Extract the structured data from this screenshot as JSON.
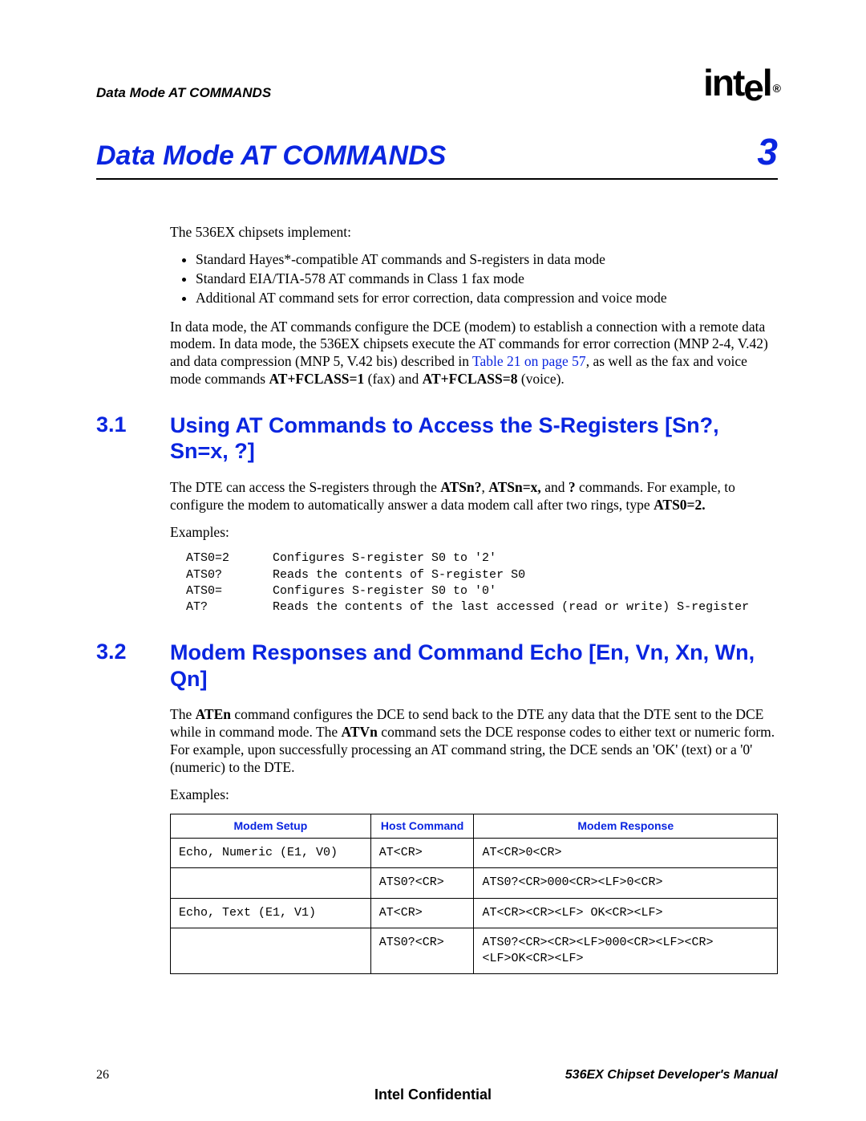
{
  "header": {
    "running_title": "Data Mode AT COMMANDS",
    "logo_text": "intel",
    "logo_reg": "®"
  },
  "chapter": {
    "title": "Data Mode AT COMMANDS",
    "number": "3"
  },
  "intro": {
    "lead": "The 536EX chipsets implement:",
    "bullets": [
      "Standard Hayes*-compatible AT commands and S-registers in data mode",
      "Standard EIA/TIA-578 AT commands in Class 1 fax mode",
      "Additional AT command sets for error correction, data compression and voice mode"
    ],
    "para_pre": "In data mode, the AT commands configure the DCE (modem) to establish a connection with a remote data modem. In data mode, the 536EX chipsets execute the AT commands for error correction (MNP 2-4, V.42) and data compression (MNP 5, V.42 bis) described in ",
    "xref": "Table 21 on page 57",
    "para_mid": ", as well as the fax and voice mode commands ",
    "cmd1": "AT+FCLASS=1",
    "mid2": " (fax) and ",
    "cmd2": "AT+FCLASS=8",
    "para_post": " (voice)."
  },
  "sec31": {
    "num": "3.1",
    "title": "Using AT Commands to Access the S-Registers [Sn?, Sn=x, ?]",
    "p1_pre": "The DTE can access the S-registers through the ",
    "p1_b1": "ATSn?",
    "p1_sep1": ", ",
    "p1_b2": "ATSn=x,",
    "p1_sep2": " and ",
    "p1_b3": "?",
    "p1_mid": " commands. For example, to configure the modem to automatically answer a data modem call after two rings, type ",
    "p1_b4": "ATS0=2.",
    "examples_label": "Examples:",
    "examples": [
      {
        "cmd": "ATS0=2",
        "desc": "Configures S-register S0 to '2'"
      },
      {
        "cmd": "ATS0?",
        "desc": "Reads the contents of S-register S0"
      },
      {
        "cmd": "ATS0=",
        "desc": "Configures S-register S0 to '0'"
      },
      {
        "cmd": "AT?",
        "desc": "Reads the contents of the last accessed (read or write) S-register"
      }
    ]
  },
  "sec32": {
    "num": "3.2",
    "title": "Modem Responses and Command Echo [En, Vn, Xn, Wn, Qn]",
    "p1_a": "The ",
    "p1_b1": "ATEn",
    "p1_b": " command configures the DCE to send back to the DTE any data that the DTE sent to the DCE while in command mode. The ",
    "p1_b2": "ATVn",
    "p1_c": " command sets the DCE response codes to either text or numeric form. For example, upon successfully processing an AT command string, the DCE sends an 'OK' (text) or a '0' (numeric) to the DTE.",
    "examples_label": "Examples:",
    "table": {
      "headers": [
        "Modem Setup",
        "Host Command",
        "Modem Response"
      ],
      "rows": [
        {
          "setup": "Echo, Numeric (E1, V0)",
          "host": "AT<CR>",
          "resp": "AT<CR>0<CR>"
        },
        {
          "setup": "",
          "host": "ATS0?<CR>",
          "resp": "ATS0?<CR>000<CR><LF>0<CR>"
        },
        {
          "setup": "Echo, Text (E1, V1)",
          "host": "AT<CR>",
          "resp": "AT<CR><CR><LF> OK<CR><LF>"
        },
        {
          "setup": "",
          "host": "ATS0?<CR>",
          "resp": "ATS0?<CR><CR><LF>000<CR><LF><CR>\n<LF>OK<CR><LF>"
        }
      ]
    }
  },
  "footer": {
    "page": "26",
    "manual": "536EX Chipset Developer's Manual",
    "confidential": "Intel Confidential"
  }
}
